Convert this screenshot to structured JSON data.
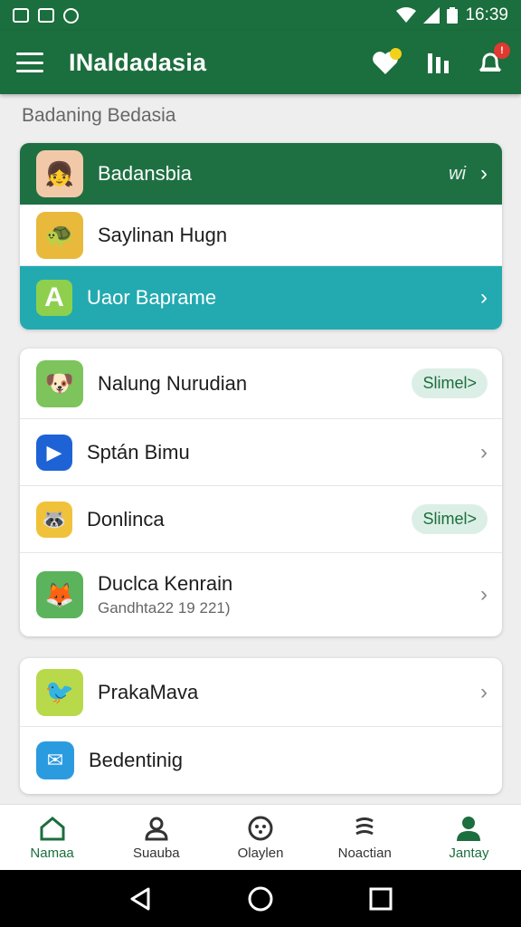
{
  "status_bar": {
    "time": "16:39"
  },
  "app_bar": {
    "title": "INaldadasia",
    "notification_count": "!"
  },
  "section": {
    "label": "Badaning Bedasia"
  },
  "group1": [
    {
      "label": "Badansbia",
      "tail": "wi"
    },
    {
      "label": "Saylinan Hugn"
    },
    {
      "label": "Uaor Baprame"
    }
  ],
  "group2": [
    {
      "label": "Nalung Nurudian",
      "pill": "Slimel>"
    },
    {
      "label": "Sptán Bimu"
    },
    {
      "label": "Donlinca",
      "pill": "Slimel>"
    },
    {
      "label": "Duclca Kenrain",
      "sub": "Gandhta22 19 221)"
    }
  ],
  "group3": [
    {
      "label": "PrakaMava"
    },
    {
      "label": "Bedentinig"
    }
  ],
  "bottom_nav": [
    {
      "label": "Namaa"
    },
    {
      "label": "Suauba"
    },
    {
      "label": "Olaylen"
    },
    {
      "label": "Noactian"
    },
    {
      "label": "Jantay"
    }
  ],
  "colors": {
    "primary": "#1b6e3d",
    "teal": "#23aab0",
    "pill_bg": "#dcefe6"
  }
}
